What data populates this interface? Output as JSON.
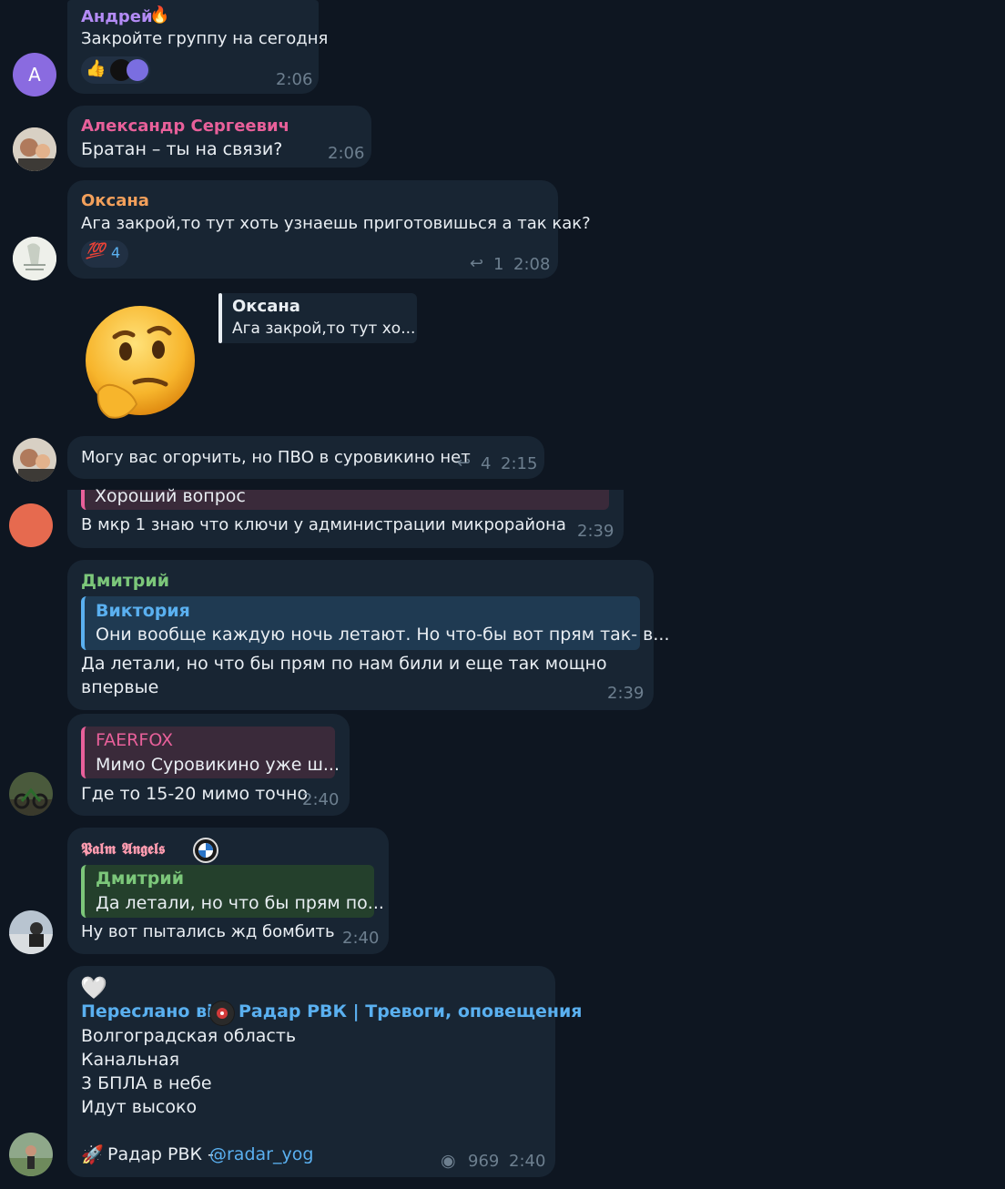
{
  "messages": {
    "m1": {
      "sender": "Андрей",
      "text": "Закройте группу на сегодня",
      "time": "2:06",
      "avatar_letter": "A",
      "colors": {
        "name": "#b38bf5",
        "avatar": "#8a6be0"
      }
    },
    "m2": {
      "sender": "Александр Сергеевич",
      "text": "Братан – ты на связи?",
      "time": "2:06",
      "colors": {
        "name": "#e8609a"
      }
    },
    "m3": {
      "sender": "Оксана",
      "text": "Ага закрой,то тут хоть узнаешь приготовишься  а так как?",
      "reaction_count": "4",
      "reply_count": "1",
      "time": "2:08",
      "colors": {
        "name": "#f3a05b"
      }
    },
    "m4": {
      "quote_name": "Оксана",
      "quote_text": "Ага закрой,то тут хо...",
      "sticker": "thinking-face"
    },
    "m5": {
      "text": "Могу вас огорчить, но ПВО в суровикино нет",
      "reply_count": "4",
      "time": "2:15"
    },
    "m6": {
      "quote_text": "Хороший вопрос",
      "text": "В мкр 1 знаю что ключи у администрации микрорайона",
      "time": "2:39",
      "colors": {
        "avatar": "#e66a4f"
      }
    },
    "m7": {
      "sender": "Дмитрий",
      "quote_name": "Виктория",
      "quote_text": "Они вообще каждую ночь летают. Но что-бы вот прям так- в...",
      "text_line1": "Да летали, но что бы  прям по нам били и еще так мощно",
      "text_line2": "впервые",
      "time": "2:39",
      "colors": {
        "name": "#7cc77a",
        "quote": "#5ab0f0"
      }
    },
    "m8": {
      "quote_name": "FAERFOX",
      "quote_text": "Мимо Суровикино уже ш...",
      "text": "Где то 15-20 мимо точно",
      "time": "2:40",
      "colors": {
        "quote": "#e8609a"
      }
    },
    "m9": {
      "sender": "𝕻𝖆𝖑𝖒 𝕬𝖓𝖌𝖊𝖑𝖘",
      "quote_name": "Дмитрий",
      "quote_text": "Да летали, но что бы  прям по...",
      "text": "Ну вот пытались жд бомбить",
      "time": "2:40",
      "colors": {
        "name": "#ff9cb0",
        "quote": "#7cc77a"
      }
    },
    "m10": {
      "heart": "🤍",
      "forwarded_prefix": "Переслано від",
      "forwarded_channel": "Радар РВК | Тревоги, оповещения",
      "lines": [
        "Волгоградская область",
        "Канальная",
        "3 БПЛА в небе",
        "Идут высоко"
      ],
      "footer_prefix": "Радар РВК - ",
      "footer_link": "@radar_yog",
      "views": "969",
      "time": "2:40",
      "colors": {
        "link": "#5ab0f0"
      }
    }
  }
}
